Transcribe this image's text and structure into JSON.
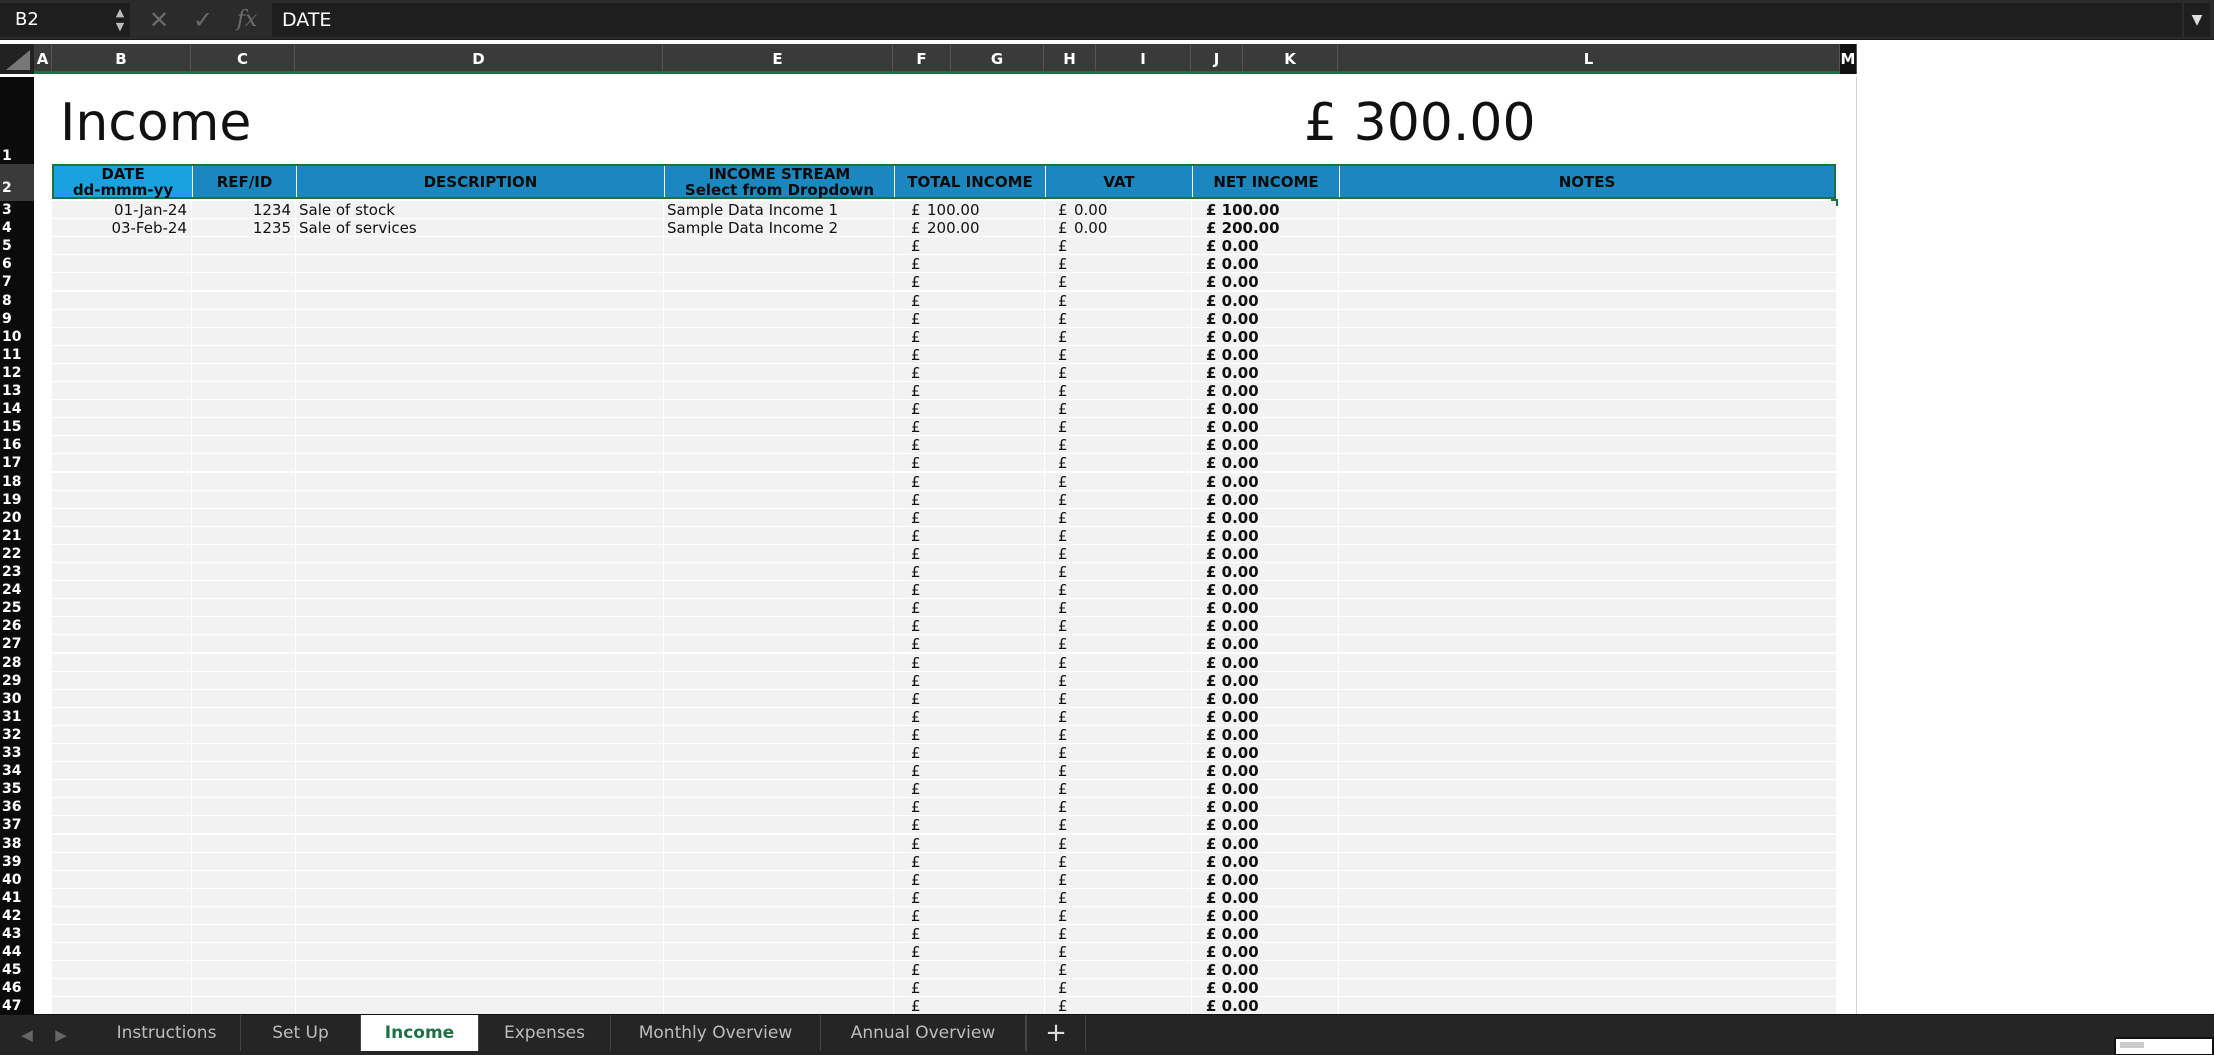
{
  "formula_bar": {
    "cell_ref": "B2",
    "value": "DATE",
    "function_symbol": "fx"
  },
  "columns": [
    "A",
    "B",
    "C",
    "D",
    "E",
    "F",
    "G",
    "H",
    "I",
    "J",
    "K",
    "L",
    "M"
  ],
  "row_numbers": [
    "1",
    "2",
    "3",
    "4",
    "5",
    "6",
    "7",
    "8",
    "9",
    "10",
    "11",
    "12",
    "13",
    "14",
    "15",
    "16",
    "17",
    "18",
    "19",
    "20",
    "21",
    "22",
    "23",
    "24",
    "25",
    "26",
    "27",
    "28",
    "29",
    "30",
    "31",
    "32",
    "33",
    "34",
    "35",
    "36",
    "37",
    "38",
    "39",
    "40",
    "41",
    "42",
    "43",
    "44",
    "45",
    "46",
    "47"
  ],
  "sheet": {
    "title": "Income",
    "total": "£ 300.00"
  },
  "table": {
    "headers": [
      {
        "line1": "DATE",
        "line2": "dd-mmm-yy"
      },
      {
        "line1": "REF/ID"
      },
      {
        "line1": "DESCRIPTION"
      },
      {
        "line1": "INCOME STREAM",
        "line2": "Select from Dropdown"
      },
      {
        "line1": "TOTAL INCOME"
      },
      {
        "line1": "VAT"
      },
      {
        "line1": "NET INCOME"
      },
      {
        "line1": "NOTES"
      }
    ],
    "rows": [
      {
        "date": "01-Jan-24",
        "ref": "1234",
        "description": "Sale of stock",
        "stream": "Sample Data Income 1",
        "total_sym": "£",
        "total": "100.00",
        "vat_sym": "£",
        "vat": "0.00",
        "net": "£ 100.00"
      },
      {
        "date": "03-Feb-24",
        "ref": "1235",
        "description": "Sale of services",
        "stream": "Sample Data Income 2",
        "total_sym": "£",
        "total": "200.00",
        "vat_sym": "£",
        "vat": "0.00",
        "net": "£ 200.00"
      }
    ],
    "empty_row_text": {
      "total_sym": "£",
      "vat_sym": "£",
      "net": "£ 0.00"
    },
    "empty_row_count": 43
  },
  "tabs": [
    {
      "label": "Instructions",
      "active": false
    },
    {
      "label": "Set Up",
      "active": false
    },
    {
      "label": "Income",
      "active": true
    },
    {
      "label": "Expenses",
      "active": false
    },
    {
      "label": "Monthly Overview",
      "active": false
    },
    {
      "label": "Annual Overview",
      "active": false
    }
  ],
  "colors": {
    "header_blue": "#1a88bf",
    "selected_header": "#18a3e0",
    "accent_green": "#1e7145",
    "row_fill": "#f2f2f2"
  }
}
